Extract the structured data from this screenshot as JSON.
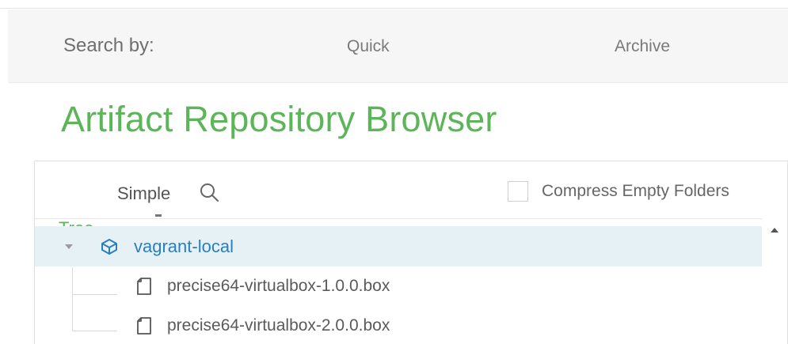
{
  "search": {
    "label": "Search by:",
    "tabs": [
      {
        "label": "Quick"
      },
      {
        "label": "Archive"
      }
    ]
  },
  "page": {
    "title": "Artifact Repository Browser"
  },
  "toolbar": {
    "tree_tab": "Tree",
    "simple_tab": "Simple",
    "compress_label": "Compress Empty Folders",
    "compress_checked": false
  },
  "tree": {
    "root": {
      "label": "vagrant-local",
      "icon": "repository-cube-icon",
      "expanded": true
    },
    "children": [
      {
        "label": "precise64-virtualbox-1.0.0.box",
        "icon": "file-icon"
      },
      {
        "label": "precise64-virtualbox-2.0.0.box",
        "icon": "file-icon"
      }
    ]
  },
  "colors": {
    "accent_green": "#5db55a",
    "link_blue": "#2a7fbf",
    "selected_row": "#e6f1f5"
  }
}
